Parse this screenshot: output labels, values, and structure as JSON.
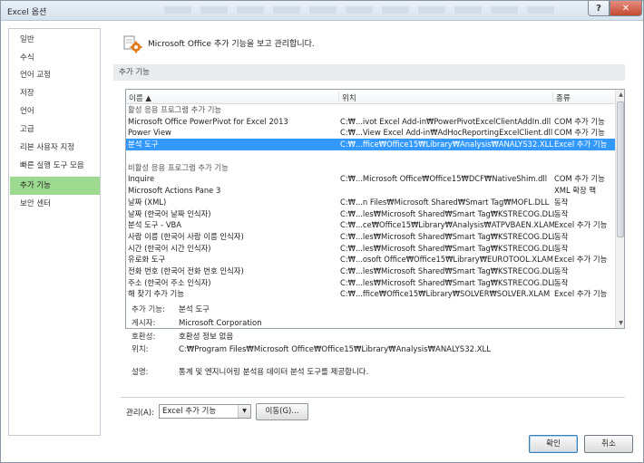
{
  "window": {
    "title": "Excel 옵션",
    "help_label": "?",
    "close_label": "✕"
  },
  "sidebar": {
    "items": [
      {
        "label": "일반"
      },
      {
        "label": "수식"
      },
      {
        "label": "언어 교정"
      },
      {
        "label": "저장"
      },
      {
        "label": "언어"
      },
      {
        "label": "고급"
      },
      {
        "label": "리본 사용자 지정"
      },
      {
        "label": "빠른 실행 도구 모음"
      },
      {
        "label": "추가 기능",
        "selected": true
      },
      {
        "label": "보안 센터"
      }
    ]
  },
  "header": {
    "text": "Microsoft Office 추가 기능을 보고 관리합니다.",
    "icon": "gear-icon",
    "icon_color": "#e07b1f"
  },
  "section": {
    "title": "추가 기능"
  },
  "list": {
    "columns": {
      "name": "이름 ▲",
      "location": "위치",
      "type": "종류"
    },
    "groups": [
      {
        "title": "활성 응용 프로그램 추가 기능",
        "rows": [
          {
            "name": "Microsoft Office PowerPivot for Excel 2013",
            "location": "C:₩...ivot Excel Add-in₩PowerPivotExcelClientAddIn.dll",
            "type": "COM 추가 기능"
          },
          {
            "name": "Power View",
            "location": "C:₩...View Excel Add-in₩AdHocReportingExcelClient.dll",
            "type": "COM 추가 기능"
          },
          {
            "name": "분석 도구",
            "location": "C:₩...ffice₩Office15₩Library₩Analysis₩ANALYS32.XLL",
            "type": "Excel 추가 기능",
            "selected": true
          }
        ]
      },
      {
        "title": "비활성 응용 프로그램 추가 기능",
        "rows": [
          {
            "name": "Inquire",
            "location": "C:₩...Microsoft Office₩Office15₩DCF₩NativeShim.dll",
            "type": "COM 추가 기능"
          },
          {
            "name": "Microsoft Actions Pane 3",
            "location": "",
            "type": "XML 확장 팩"
          },
          {
            "name": "날짜 (XML)",
            "location": "C:₩...n Files₩Microsoft Shared₩Smart Tag₩MOFL.DLL",
            "type": "동작"
          },
          {
            "name": "날짜 (한국어 날짜 인식자)",
            "location": "C:₩...les₩Microsoft Shared₩Smart Tag₩KSTRECOG.DLL",
            "type": "동작"
          },
          {
            "name": "분석 도구 - VBA",
            "location": "C:₩...ce₩Office15₩Library₩Analysis₩ATPVBAEN.XLAM",
            "type": "Excel 추가 기능"
          },
          {
            "name": "사람 이름 (한국어 사람 이름 인식자)",
            "location": "C:₩...les₩Microsoft Shared₩Smart Tag₩KSTRECOG.DLL",
            "type": "동작"
          },
          {
            "name": "시간 (한국어 시간 인식자)",
            "location": "C:₩...les₩Microsoft Shared₩Smart Tag₩KSTRECOG.DLL",
            "type": "동작"
          },
          {
            "name": "유로화 도구",
            "location": "C:₩...osoft Office₩Office15₩Library₩EUROTOOL.XLAM",
            "type": "Excel 추가 기능"
          },
          {
            "name": "전화 번호 (한국어 전화 번호 인식자)",
            "location": "C:₩...les₩Microsoft Shared₩Smart Tag₩KSTRECOG.DLL",
            "type": "동작"
          },
          {
            "name": "주소 (한국어 주소 인식자)",
            "location": "C:₩...les₩Microsoft Shared₩Smart Tag₩KSTRECOG.DLL",
            "type": "동작"
          },
          {
            "name": "해 찾기 추가 기능",
            "location": "C:₩...ffice₩Office15₩Library₩SOLVER₩SOLVER.XLAM",
            "type": "Excel 추가 기능"
          }
        ]
      }
    ],
    "scroll_up": "▲",
    "scroll_down": "▼"
  },
  "details": {
    "addin_label": "추가 기능:",
    "addin_value": "분석 도구",
    "publisher_label": "게시자:",
    "publisher_value": "Microsoft Corporation",
    "compat_label": "호환성:",
    "compat_value": "호환성 정보 없음",
    "location_label": "위치:",
    "location_value": "C:₩Program Files₩Microsoft Office₩Office15₩Library₩Analysis₩ANALYS32.XLL",
    "desc_label": "설명:",
    "desc_value": "통계 및 엔지니어링 분석용 데이터 분석 도구를 제공합니다."
  },
  "manage": {
    "label": "관리(A):",
    "selected": "Excel 추가 기능",
    "go_label": "이동(G)..."
  },
  "footer": {
    "ok_label": "확인",
    "cancel_label": "취소"
  },
  "colors": {
    "sidebar_selected": "#9dd98f",
    "row_selected": "#3399ff"
  }
}
